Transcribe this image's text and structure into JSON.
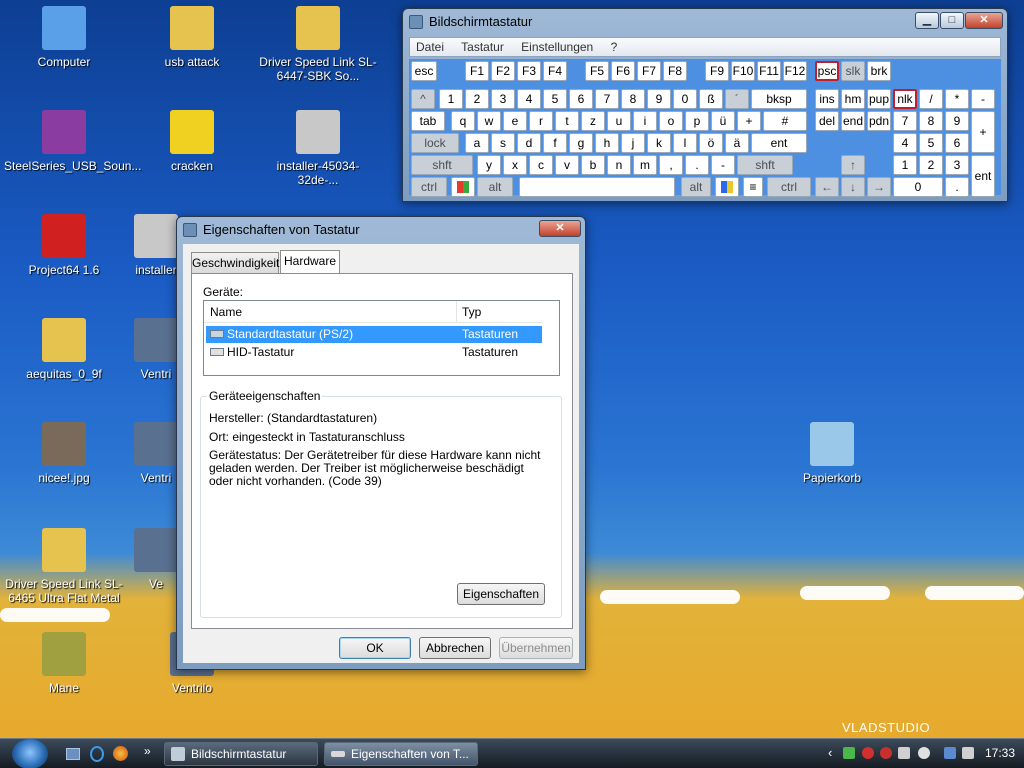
{
  "desktop": {
    "icons": [
      {
        "label": "Computer",
        "color": "#5aa0e8"
      },
      {
        "label": "usb attack",
        "color": "#e6c24e"
      },
      {
        "label": "Driver Speed Link SL-6447-SBK So...",
        "color": "#e6c24e"
      },
      {
        "label": "SteelSeries_USB_Soun...",
        "color": "#8a3ca0"
      },
      {
        "label": "cracken",
        "color": "#f0d020"
      },
      {
        "label": "installer-45034-32de-...",
        "color": "#c8c8c8"
      },
      {
        "label": "Project64 1.6",
        "color": "#d02020"
      },
      {
        "label": "installer",
        "color": "#c8c8c8"
      },
      {
        "label": "aequitas_0_9f",
        "color": "#e6c24e"
      },
      {
        "label": "Ventri",
        "color": "#5a7090"
      },
      {
        "label": "nicee!.jpg",
        "color": "#7a6a5a"
      },
      {
        "label": "Ventri",
        "color": "#5a7090"
      },
      {
        "label": "Driver Speed Link SL-6465 Ultra Flat Metal",
        "color": "#e6c24e"
      },
      {
        "label": "Ve",
        "color": "#5a7090"
      },
      {
        "label": "Mane",
        "color": "#a0a040"
      },
      {
        "label": "Ventrilo",
        "color": "#5a7090"
      },
      {
        "label": "Papierkorb",
        "color": "#9ac8e8"
      }
    ],
    "watermark": "VLADSTUDIO"
  },
  "osk": {
    "title": "Bildschirmtastatur",
    "menu": [
      "Datei",
      "Tastatur",
      "Einstellungen",
      "?"
    ],
    "row1": [
      "esc",
      "F1",
      "F2",
      "F3",
      "F4",
      "F5",
      "F6",
      "F7",
      "F8",
      "F9",
      "F10",
      "F11",
      "F12",
      "psc",
      "slk",
      "brk"
    ],
    "row2": [
      "^",
      "1",
      "2",
      "3",
      "4",
      "5",
      "6",
      "7",
      "8",
      "9",
      "0",
      "ß",
      "´",
      "bksp",
      "ins",
      "hm",
      "pup",
      "nlk",
      "/",
      "*",
      "-"
    ],
    "row3": [
      "tab",
      "q",
      "w",
      "e",
      "r",
      "t",
      "z",
      "u",
      "i",
      "o",
      "p",
      "ü",
      "+",
      "#",
      "del",
      "end",
      "pdn",
      "7",
      "8",
      "9",
      "+"
    ],
    "row4": [
      "lock",
      "a",
      "s",
      "d",
      "f",
      "g",
      "h",
      "j",
      "k",
      "l",
      "ö",
      "ä",
      "ent",
      "4",
      "5",
      "6"
    ],
    "row5": [
      "shft",
      "y",
      "x",
      "c",
      "v",
      "b",
      "n",
      "m",
      ",",
      ".",
      "-",
      "shft",
      "↑",
      "1",
      "2",
      "3",
      "ent"
    ],
    "row6": [
      "ctrl",
      "alt",
      "alt",
      "ctrl",
      "←",
      "↓",
      "→",
      "0",
      "."
    ]
  },
  "dialog": {
    "title": "Eigenschaften von Tastatur",
    "tabs": [
      "Geschwindigkeit",
      "Hardware"
    ],
    "devices_label": "Geräte:",
    "columns": [
      "Name",
      "Typ"
    ],
    "devices": [
      {
        "name": "Standardtastatur (PS/2)",
        "type": "Tastaturen"
      },
      {
        "name": "HID-Tastatur",
        "type": "Tastaturen"
      }
    ],
    "props_group": "Geräteeigenschaften",
    "manufacturer": "Hersteller: (Standardtastaturen)",
    "location": "Ort: eingesteckt in Tastaturanschluss",
    "status": "Gerätestatus: Der Gerätetreiber für diese Hardware kann nicht geladen werden. Der Treiber ist möglicherweise beschädigt oder nicht vorhanden. (Code 39)",
    "properties_btn": "Eigenschaften",
    "ok": "OK",
    "cancel": "Abbrechen",
    "apply": "Übernehmen"
  },
  "taskbar": {
    "tasks": [
      "Bildschirmtastatur",
      "Eigenschaften von T..."
    ],
    "clock": "17:33",
    "chevron": "»",
    "tray_chevron": "‹"
  }
}
